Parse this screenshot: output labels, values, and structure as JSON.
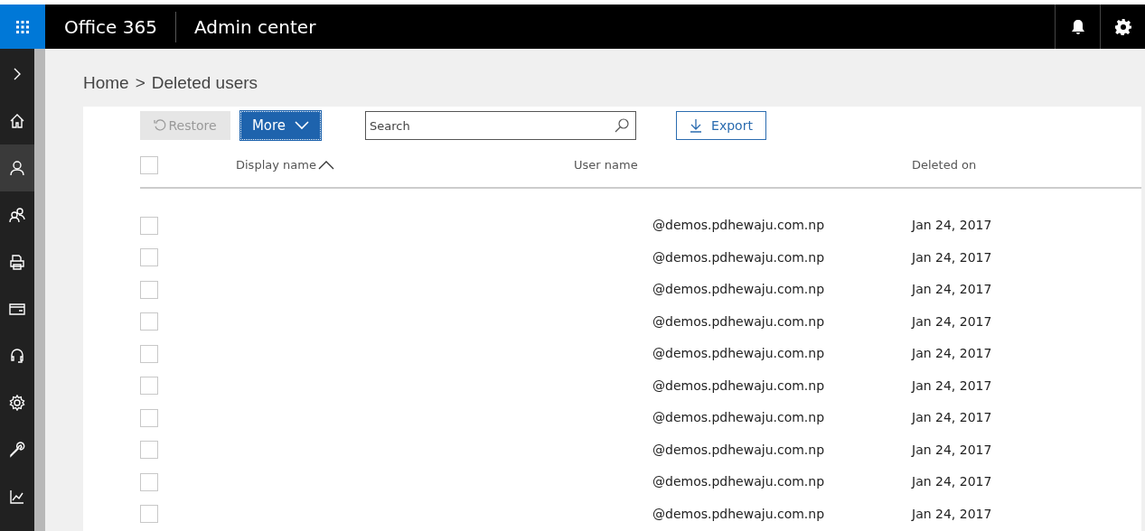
{
  "header": {
    "product": "Office 365",
    "app": "Admin center"
  },
  "nav": [
    {
      "kind": "expand",
      "selected": false
    },
    {
      "kind": "home",
      "selected": false
    },
    {
      "kind": "user",
      "selected": true
    },
    {
      "kind": "users",
      "selected": false
    },
    {
      "kind": "devices",
      "selected": false
    },
    {
      "kind": "billing",
      "selected": false
    },
    {
      "kind": "support",
      "selected": false
    },
    {
      "kind": "settings",
      "selected": false
    },
    {
      "kind": "setup",
      "selected": false
    },
    {
      "kind": "reports",
      "selected": false
    }
  ],
  "breadcrumb": {
    "items": [
      "Home",
      "Deleted users"
    ],
    "separator": ">"
  },
  "toolbar": {
    "restore": {
      "label": "Restore",
      "disabled": true
    },
    "more": {
      "label": "More"
    },
    "search": {
      "placeholder": "Search"
    },
    "export": {
      "label": "Export"
    }
  },
  "table": {
    "select_all_checked": false,
    "columns": [
      {
        "label": "Display name",
        "sorted": true
      },
      {
        "label": "User name",
        "sorted": false
      },
      {
        "label": "Deleted on",
        "sorted": false
      }
    ],
    "rows": [
      {
        "user_name": "@demos.pdhewaju.com.np",
        "deleted_on": "Jan 24, 2017",
        "checked": false
      },
      {
        "user_name": "@demos.pdhewaju.com.np",
        "deleted_on": "Jan 24, 2017",
        "checked": false
      },
      {
        "user_name": "@demos.pdhewaju.com.np",
        "deleted_on": "Jan 24, 2017",
        "checked": false
      },
      {
        "user_name": "@demos.pdhewaju.com.np",
        "deleted_on": "Jan 24, 2017",
        "checked": false
      },
      {
        "user_name": "@demos.pdhewaju.com.np",
        "deleted_on": "Jan 24, 2017",
        "checked": false
      },
      {
        "user_name": "@demos.pdhewaju.com.np",
        "deleted_on": "Jan 24, 2017",
        "checked": false
      },
      {
        "user_name": "@demos.pdhewaju.com.np",
        "deleted_on": "Jan 24, 2017",
        "checked": false
      },
      {
        "user_name": "@demos.pdhewaju.com.np",
        "deleted_on": "Jan 24, 2017",
        "checked": false
      },
      {
        "user_name": "@demos.pdhewaju.com.np",
        "deleted_on": "Jan 24, 2017",
        "checked": false
      },
      {
        "user_name": "@demos.pdhewaju.com.np",
        "deleted_on": "Jan 24, 2017",
        "checked": false
      }
    ]
  }
}
